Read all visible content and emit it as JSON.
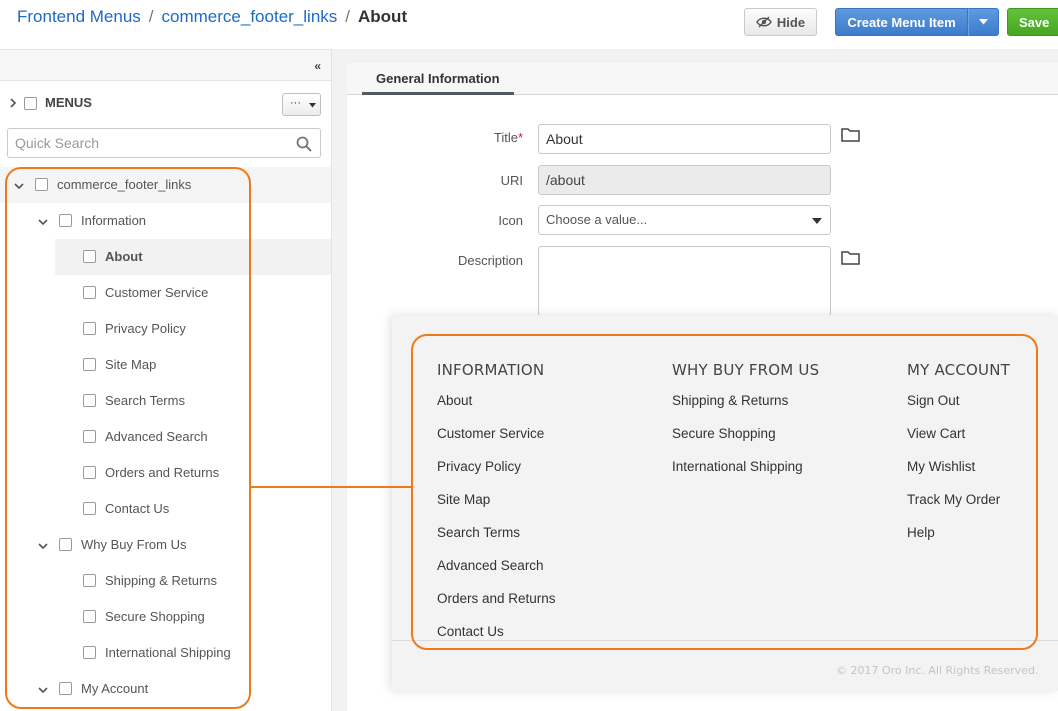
{
  "breadcrumb": {
    "root": "Frontend Menus",
    "menu": "commerce_footer_links",
    "current": "About",
    "separator": "/"
  },
  "toolbar": {
    "hide_label": "Hide",
    "create_label": "Create Menu Item",
    "save_label": "Save"
  },
  "sidebar": {
    "menus_label": "MENUS",
    "menus_dropdown": "···",
    "search_placeholder": "Quick Search",
    "tree": {
      "root": "commerce_footer_links",
      "groups": [
        {
          "label": "Information",
          "items": [
            "About",
            "Customer Service",
            "Privacy Policy",
            "Site Map",
            "Search Terms",
            "Advanced Search",
            "Orders and Returns",
            "Contact Us"
          ]
        },
        {
          "label": "Why Buy From Us",
          "items": [
            "Shipping & Returns",
            "Secure Shopping",
            "International Shipping"
          ]
        },
        {
          "label": "My Account",
          "items": []
        }
      ],
      "selected": "About"
    }
  },
  "form": {
    "tab": "General Information",
    "title_label": "Title",
    "required_mark": "*",
    "title_value": "About",
    "uri_label": "URI",
    "uri_value": "/about",
    "icon_label": "Icon",
    "icon_placeholder": "Choose a value...",
    "description_label": "Description"
  },
  "footer_preview": {
    "columns": [
      {
        "heading": "INFORMATION",
        "links": [
          "About",
          "Customer Service",
          "Privacy Policy",
          "Site Map",
          "Search Terms",
          "Advanced Search",
          "Orders and Returns",
          "Contact Us"
        ]
      },
      {
        "heading": "WHY BUY FROM US",
        "links": [
          "Shipping & Returns",
          "Secure Shopping",
          "International Shipping"
        ]
      },
      {
        "heading": "MY ACCOUNT",
        "links": [
          "Sign Out",
          "View Cart",
          "My Wishlist",
          "Track My Order",
          "Help"
        ]
      }
    ],
    "copyright": "© 2017 Oro Inc. All Rights Reserved."
  },
  "colors": {
    "link": "#1c6ac9",
    "primary": "#3c7ccb",
    "success": "#45a521",
    "highlight": "#f07a1a"
  }
}
